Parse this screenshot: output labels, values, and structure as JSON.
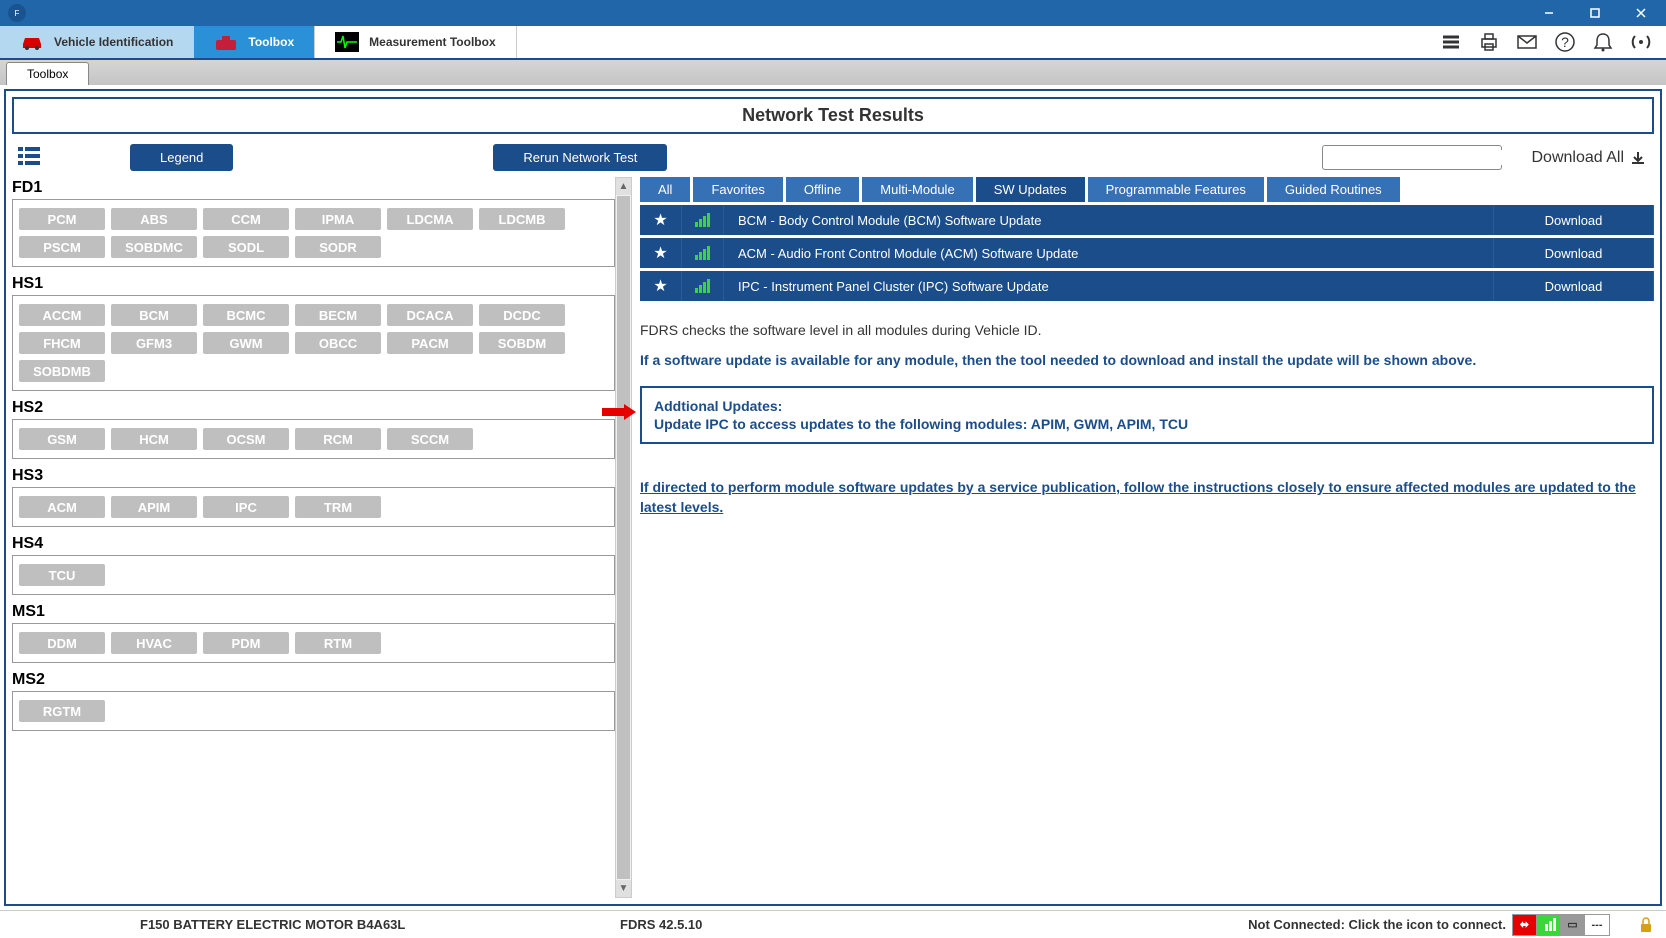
{
  "titlebar": {
    "app_name": "FDRS"
  },
  "nav": {
    "tabs": [
      {
        "label": "Vehicle Identification"
      },
      {
        "label": "Toolbox"
      },
      {
        "label": "Measurement Toolbox"
      }
    ]
  },
  "sub_tab": "Toolbox",
  "page_title": "Network Test Results",
  "toolbar": {
    "legend": "Legend",
    "rerun": "Rerun Network Test",
    "download_all": "Download All"
  },
  "networks": [
    {
      "name": "FD1",
      "modules": [
        "PCM",
        "ABS",
        "CCM",
        "IPMA",
        "LDCMA",
        "LDCMB",
        "PSCM",
        "SOBDMC",
        "SODL",
        "SODR"
      ]
    },
    {
      "name": "HS1",
      "modules": [
        "ACCM",
        "BCM",
        "BCMC",
        "BECM",
        "DCACA",
        "DCDC",
        "FHCM",
        "GFM3",
        "GWM",
        "OBCC",
        "PACM",
        "SOBDM",
        "SOBDMB"
      ]
    },
    {
      "name": "HS2",
      "modules": [
        "GSM",
        "HCM",
        "OCSM",
        "RCM",
        "SCCM"
      ]
    },
    {
      "name": "HS3",
      "modules": [
        "ACM",
        "APIM",
        "IPC",
        "TRM"
      ]
    },
    {
      "name": "HS4",
      "modules": [
        "TCU"
      ]
    },
    {
      "name": "MS1",
      "modules": [
        "DDM",
        "HVAC",
        "PDM",
        "RTM"
      ]
    },
    {
      "name": "MS2",
      "modules": [
        "RGTM"
      ]
    }
  ],
  "filters": [
    "All",
    "Favorites",
    "Offline",
    "Multi-Module",
    "SW Updates",
    "Programmable Features",
    "Guided Routines"
  ],
  "updates": [
    {
      "name": "BCM - Body Control Module (BCM) Software Update",
      "action": "Download"
    },
    {
      "name": "ACM - Audio Front Control Module (ACM) Software Update",
      "action": "Download"
    },
    {
      "name": "IPC - Instrument Panel Cluster (IPC) Software Update",
      "action": "Download"
    }
  ],
  "info": {
    "line1": "FDRS checks the software level in all modules during Vehicle ID.",
    "line2": "If a software update is available for any module, then the tool needed to download and install the update will be shown above.",
    "box_title": "Addtional Updates:",
    "box_body": "Update IPC to access updates to the following modules: APIM, GWM, APIM, TCU",
    "underline": "If directed to perform module software updates by a service publication, follow the instructions closely to ensure affected modules are updated to the latest levels."
  },
  "status": {
    "vehicle": "F150 BATTERY ELECTRIC MOTOR B4A63L",
    "version": "FDRS 42.5.10",
    "connection": "Not Connected: Click the icon to connect."
  }
}
